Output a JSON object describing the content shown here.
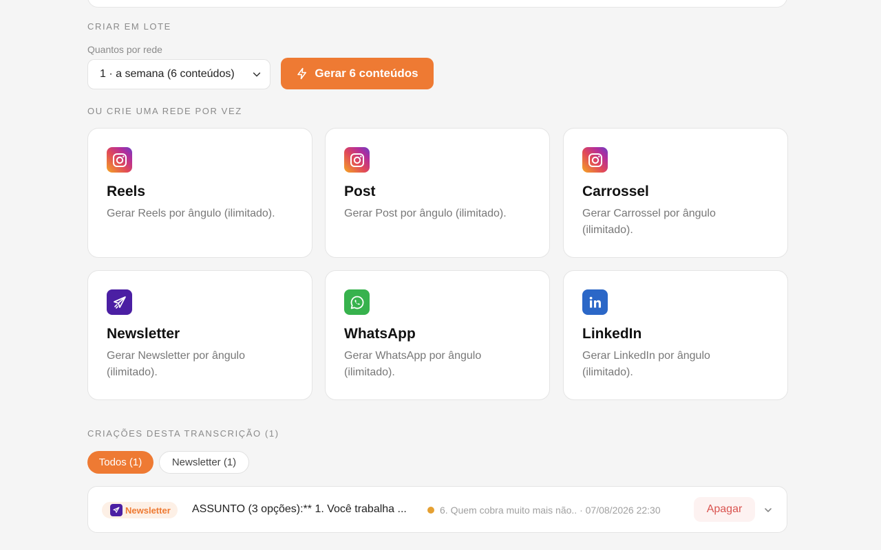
{
  "batch": {
    "section_title": "CRIAR EM LOTE",
    "quantity_label": "Quantos por rede",
    "quantity_value": "1 · a semana (6 conteúdos)",
    "generate_label": "Gerar 6 conteúdos"
  },
  "single": {
    "section_title": "OU CRIE UMA REDE POR VEZ",
    "cards": [
      {
        "title": "Reels",
        "description": "Gerar Reels por ângulo (ilimitado).",
        "icon": "instagram-icon"
      },
      {
        "title": "Post",
        "description": "Gerar Post por ângulo (ilimitado).",
        "icon": "instagram-icon"
      },
      {
        "title": "Carrossel",
        "description": "Gerar Carrossel por ângulo (ilimitado).",
        "icon": "instagram-icon"
      },
      {
        "title": "Newsletter",
        "description": "Gerar Newsletter por ângulo (ilimitado).",
        "icon": "paper-plane-icon"
      },
      {
        "title": "WhatsApp",
        "description": "Gerar WhatsApp por ângulo (ilimitado).",
        "icon": "whatsapp-icon"
      },
      {
        "title": "LinkedIn",
        "description": "Gerar LinkedIn por ângulo (ilimitado).",
        "icon": "linkedin-icon"
      }
    ]
  },
  "creations": {
    "section_title": "CRIAÇÕES DESTA TRANSCRIÇÃO (1)",
    "filters": [
      {
        "label": "Todos (1)",
        "active": true
      },
      {
        "label": "Newsletter (1)",
        "active": false
      }
    ],
    "items": [
      {
        "badge": "Newsletter",
        "title": "ASSUNTO (3 opções):** 1. Você trabalha ...",
        "meta": "6. Quem cobra muito mais não.. · 07/08/2026 22:30",
        "delete_label": "Apagar",
        "status_color": "#e5a032"
      }
    ]
  },
  "colors": {
    "accent": "#ee7a33",
    "newsletter": "#4b1fa3",
    "whatsapp": "#37b24d",
    "linkedin": "#2b67c7",
    "danger": "#d9534f"
  }
}
